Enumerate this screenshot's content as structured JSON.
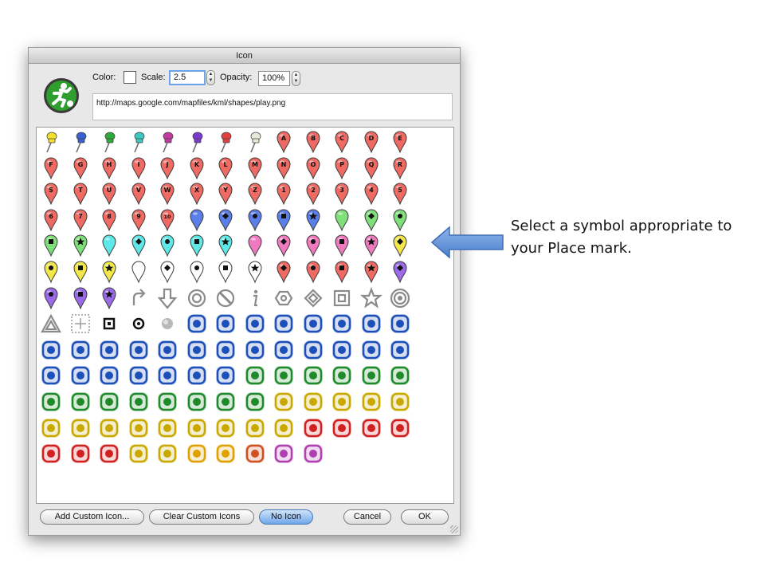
{
  "window": {
    "title": "Icon"
  },
  "preview": {
    "icon": "play-icon",
    "color": "#2e9e2e"
  },
  "controls": {
    "color_label": "Color:",
    "scale_label": "Scale:",
    "scale_value": "2.5",
    "opacity_label": "Opacity:",
    "opacity_value": "100%",
    "url": "http://maps.google.com/mapfiles/kml/shapes/play.png"
  },
  "buttons": {
    "add_custom": "Add Custom Icon...",
    "clear_custom": "Clear Custom Icons",
    "no_icon": "No Icon",
    "cancel": "Cancel",
    "ok": "OK"
  },
  "annotation": {
    "text": "Select a symbol appropriate to your Place mark.",
    "arrow_color": "#5b8fd6"
  },
  "icon_grid": {
    "rows": [
      [
        {
          "kind": "pushpin",
          "color": "#f2e02a"
        },
        {
          "kind": "pushpin",
          "color": "#3a5fd0"
        },
        {
          "kind": "pushpin",
          "color": "#2eaa3a"
        },
        {
          "kind": "pushpin",
          "color": "#3ac8c0"
        },
        {
          "kind": "pushpin",
          "color": "#c03aa0"
        },
        {
          "kind": "pushpin",
          "color": "#7a3ad0"
        },
        {
          "kind": "pushpin",
          "color": "#e04040"
        },
        {
          "kind": "pushpin",
          "color": "#e8e8d8"
        },
        {
          "kind": "pin",
          "color": "#ef6a62",
          "label": "A"
        },
        {
          "kind": "pin",
          "color": "#ef6a62",
          "label": "B"
        },
        {
          "kind": "pin",
          "color": "#ef6a62",
          "label": "C"
        },
        {
          "kind": "pin",
          "color": "#ef6a62",
          "label": "D"
        },
        {
          "kind": "pin",
          "color": "#ef6a62",
          "label": "E"
        }
      ],
      [
        {
          "kind": "pin",
          "color": "#ef6a62",
          "label": "F"
        },
        {
          "kind": "pin",
          "color": "#ef6a62",
          "label": "G"
        },
        {
          "kind": "pin",
          "color": "#ef6a62",
          "label": "H"
        },
        {
          "kind": "pin",
          "color": "#ef6a62",
          "label": "I"
        },
        {
          "kind": "pin",
          "color": "#ef6a62",
          "label": "J"
        },
        {
          "kind": "pin",
          "color": "#ef6a62",
          "label": "K"
        },
        {
          "kind": "pin",
          "color": "#ef6a62",
          "label": "L"
        },
        {
          "kind": "pin",
          "color": "#ef6a62",
          "label": "M"
        },
        {
          "kind": "pin",
          "color": "#ef6a62",
          "label": "N"
        },
        {
          "kind": "pin",
          "color": "#ef6a62",
          "label": "O"
        },
        {
          "kind": "pin",
          "color": "#ef6a62",
          "label": "P"
        },
        {
          "kind": "pin",
          "color": "#ef6a62",
          "label": "Q"
        },
        {
          "kind": "pin",
          "color": "#ef6a62",
          "label": "R"
        }
      ],
      [
        {
          "kind": "pin",
          "color": "#ef6a62",
          "label": "S"
        },
        {
          "kind": "pin",
          "color": "#ef6a62",
          "label": "T"
        },
        {
          "kind": "pin",
          "color": "#ef6a62",
          "label": "U"
        },
        {
          "kind": "pin",
          "color": "#ef6a62",
          "label": "V"
        },
        {
          "kind": "pin",
          "color": "#ef6a62",
          "label": "W"
        },
        {
          "kind": "pin",
          "color": "#ef6a62",
          "label": "X"
        },
        {
          "kind": "pin",
          "color": "#ef6a62",
          "label": "Y"
        },
        {
          "kind": "pin",
          "color": "#ef6a62",
          "label": "Z"
        },
        {
          "kind": "pin",
          "color": "#ef6a62",
          "label": "1"
        },
        {
          "kind": "pin",
          "color": "#ef6a62",
          "label": "2"
        },
        {
          "kind": "pin",
          "color": "#ef6a62",
          "label": "3"
        },
        {
          "kind": "pin",
          "color": "#ef6a62",
          "label": "4"
        },
        {
          "kind": "pin",
          "color": "#ef6a62",
          "label": "5"
        }
      ],
      [
        {
          "kind": "pin",
          "color": "#ef6a62",
          "label": "6"
        },
        {
          "kind": "pin",
          "color": "#ef6a62",
          "label": "7"
        },
        {
          "kind": "pin",
          "color": "#ef6a62",
          "label": "8"
        },
        {
          "kind": "pin",
          "color": "#ef6a62",
          "label": "9"
        },
        {
          "kind": "pin",
          "color": "#ef6a62",
          "label": "10"
        },
        {
          "kind": "pin",
          "color": "#5b7fe8"
        },
        {
          "kind": "pin",
          "color": "#5b7fe8",
          "glyph": "diamond"
        },
        {
          "kind": "pin",
          "color": "#5b7fe8",
          "glyph": "dot"
        },
        {
          "kind": "pin",
          "color": "#5b7fe8",
          "glyph": "square"
        },
        {
          "kind": "pin",
          "color": "#5b7fe8",
          "glyph": "star"
        },
        {
          "kind": "pin",
          "color": "#7fe07a"
        },
        {
          "kind": "pin",
          "color": "#7fe07a",
          "glyph": "diamond"
        },
        {
          "kind": "pin",
          "color": "#7fe07a",
          "glyph": "dot"
        }
      ],
      [
        {
          "kind": "pin",
          "color": "#7fe07a",
          "glyph": "square"
        },
        {
          "kind": "pin",
          "color": "#7fe07a",
          "glyph": "star"
        },
        {
          "kind": "pin",
          "color": "#5fe8e8"
        },
        {
          "kind": "pin",
          "color": "#5fe8e8",
          "glyph": "diamond"
        },
        {
          "kind": "pin",
          "color": "#5fe8e8",
          "glyph": "dot"
        },
        {
          "kind": "pin",
          "color": "#5fe8e8",
          "glyph": "square"
        },
        {
          "kind": "pin",
          "color": "#5fe8e8",
          "glyph": "star"
        },
        {
          "kind": "pin",
          "color": "#f07ac0"
        },
        {
          "kind": "pin",
          "color": "#f07ac0",
          "glyph": "diamond"
        },
        {
          "kind": "pin",
          "color": "#f07ac0",
          "glyph": "dot"
        },
        {
          "kind": "pin",
          "color": "#f07ac0",
          "glyph": "square"
        },
        {
          "kind": "pin",
          "color": "#f07ac0",
          "glyph": "star"
        },
        {
          "kind": "pin",
          "color": "#f2e84a",
          "glyph": "diamond"
        }
      ],
      [
        {
          "kind": "pin",
          "color": "#f2e84a",
          "glyph": "dot"
        },
        {
          "kind": "pin",
          "color": "#f2e84a",
          "glyph": "square"
        },
        {
          "kind": "pin",
          "color": "#f2e84a",
          "glyph": "star"
        },
        {
          "kind": "pin",
          "color": "#ffffff"
        },
        {
          "kind": "pin",
          "color": "#ffffff",
          "glyph": "diamond"
        },
        {
          "kind": "pin",
          "color": "#ffffff",
          "glyph": "dot"
        },
        {
          "kind": "pin",
          "color": "#ffffff",
          "glyph": "square"
        },
        {
          "kind": "pin",
          "color": "#ffffff",
          "glyph": "star"
        },
        {
          "kind": "pin",
          "color": "#ef6a62",
          "glyph": "diamond"
        },
        {
          "kind": "pin",
          "color": "#ef6a62",
          "glyph": "dot"
        },
        {
          "kind": "pin",
          "color": "#ef6a62",
          "glyph": "square"
        },
        {
          "kind": "pin",
          "color": "#ef6a62",
          "glyph": "star"
        },
        {
          "kind": "pin",
          "color": "#9a6ae8",
          "glyph": "diamond"
        }
      ],
      [
        {
          "kind": "pin",
          "color": "#9a6ae8",
          "glyph": "dot"
        },
        {
          "kind": "pin",
          "color": "#9a6ae8",
          "glyph": "square"
        },
        {
          "kind": "pin",
          "color": "#9a6ae8",
          "glyph": "star"
        },
        {
          "kind": "shape",
          "name": "turn-arrow-icon"
        },
        {
          "kind": "shape",
          "name": "down-arrow-icon"
        },
        {
          "kind": "shape",
          "name": "target-circle-icon"
        },
        {
          "kind": "shape",
          "name": "no-entry-icon"
        },
        {
          "kind": "shape",
          "name": "info-i-icon"
        },
        {
          "kind": "shape",
          "name": "hexagon-icon"
        },
        {
          "kind": "shape",
          "name": "diamond-outline-icon"
        },
        {
          "kind": "shape",
          "name": "square-outline-icon"
        },
        {
          "kind": "shape",
          "name": "star-outline-icon"
        },
        {
          "kind": "shape",
          "name": "bullseye-icon"
        }
      ],
      [
        {
          "kind": "shape",
          "name": "triangle-outline-icon"
        },
        {
          "kind": "shape",
          "name": "crosshair-square-icon"
        },
        {
          "kind": "shape",
          "name": "small-square-icon"
        },
        {
          "kind": "shape",
          "name": "small-dot-icon"
        },
        {
          "kind": "shape",
          "name": "gray-sphere-icon"
        },
        {
          "kind": "symbol",
          "name": "dining-icon",
          "color": "#1d4fb8"
        },
        {
          "kind": "symbol",
          "name": "coffee-icon",
          "color": "#1d4fb8"
        },
        {
          "kind": "symbol",
          "name": "bar-icon",
          "color": "#1d4fb8"
        },
        {
          "kind": "symbol",
          "name": "snack-bar-icon",
          "color": "#1d4fb8"
        },
        {
          "kind": "symbol",
          "name": "man-icon",
          "color": "#1d4fb8"
        },
        {
          "kind": "symbol",
          "name": "woman-icon",
          "color": "#1d4fb8"
        },
        {
          "kind": "symbol",
          "name": "wheelchair-icon",
          "color": "#1d4fb8"
        },
        {
          "kind": "symbol",
          "name": "parking-icon",
          "color": "#1d4fb8"
        }
      ],
      [
        {
          "kind": "symbol",
          "name": "car-icon",
          "color": "#1d4fb8"
        },
        {
          "kind": "symbol",
          "name": "bus-icon",
          "color": "#1d4fb8"
        },
        {
          "kind": "symbol",
          "name": "truck-icon",
          "color": "#1d4fb8"
        },
        {
          "kind": "symbol",
          "name": "rail-icon",
          "color": "#1d4fb8"
        },
        {
          "kind": "symbol",
          "name": "airport-icon",
          "color": "#1d4fb8"
        },
        {
          "kind": "symbol",
          "name": "ferry-icon",
          "color": "#1d4fb8"
        },
        {
          "kind": "symbol",
          "name": "helicopter-icon",
          "color": "#1d4fb8"
        },
        {
          "kind": "symbol",
          "name": "subway-icon",
          "color": "#1d4fb8"
        },
        {
          "kind": "symbol",
          "name": "tram-icon",
          "color": "#1d4fb8"
        },
        {
          "kind": "symbol",
          "name": "info-icon",
          "color": "#1d4fb8"
        },
        {
          "kind": "symbol",
          "name": "question-icon",
          "color": "#1d4fb8"
        },
        {
          "kind": "symbol",
          "name": "flag-icon",
          "color": "#1d4fb8"
        },
        {
          "kind": "symbol",
          "name": "rain-cloud-icon",
          "color": "#1d4fb8"
        }
      ],
      [
        {
          "kind": "symbol",
          "name": "water-waves-icon",
          "color": "#1d4fb8"
        },
        {
          "kind": "symbol",
          "name": "snowflake-icon",
          "color": "#1d4fb8"
        },
        {
          "kind": "symbol",
          "name": "anchor-icon",
          "color": "#1d4fb8"
        },
        {
          "kind": "symbol",
          "name": "fishing-icon",
          "color": "#1d4fb8"
        },
        {
          "kind": "symbol",
          "name": "sailing-icon",
          "color": "#1d4fb8"
        },
        {
          "kind": "symbol",
          "name": "swimming-icon",
          "color": "#1d4fb8"
        },
        {
          "kind": "symbol",
          "name": "ski-icon",
          "color": "#1d4fb8"
        },
        {
          "kind": "symbol",
          "name": "tree-icon",
          "color": "#1f8a2a"
        },
        {
          "kind": "symbol",
          "name": "campfire-icon",
          "color": "#1f8a2a"
        },
        {
          "kind": "symbol",
          "name": "picnic-icon",
          "color": "#1f8a2a"
        },
        {
          "kind": "symbol",
          "name": "camping-icon",
          "color": "#1f8a2a"
        },
        {
          "kind": "symbol",
          "name": "ranger-station-icon",
          "color": "#1f8a2a"
        },
        {
          "kind": "symbol",
          "name": "toilets-icon",
          "color": "#1f8a2a"
        }
      ],
      [
        {
          "kind": "symbol",
          "name": "poi-arrow-icon",
          "color": "#1f8a2a"
        },
        {
          "kind": "symbol",
          "name": "hiking-icon",
          "color": "#1f8a2a"
        },
        {
          "kind": "symbol",
          "name": "cycling-icon",
          "color": "#1f8a2a"
        },
        {
          "kind": "symbol",
          "name": "motorbike-icon",
          "color": "#1f8a2a"
        },
        {
          "kind": "symbol",
          "name": "horse-riding-icon",
          "color": "#1f8a2a"
        },
        {
          "kind": "symbol",
          "name": "play-icon",
          "color": "#1f8a2a"
        },
        {
          "kind": "symbol",
          "name": "golf-icon",
          "color": "#1f8a2a"
        },
        {
          "kind": "symbol",
          "name": "trail-icon",
          "color": "#1f8a2a"
        },
        {
          "kind": "symbol",
          "name": "shopping-icon",
          "color": "#c9a800"
        },
        {
          "kind": "symbol",
          "name": "movies-icon",
          "color": "#c9a800"
        },
        {
          "kind": "symbol",
          "name": "grocery-icon",
          "color": "#c9a800"
        },
        {
          "kind": "symbol",
          "name": "convenience-icon",
          "color": "#c9a800"
        },
        {
          "kind": "symbol",
          "name": "arts-icon",
          "color": "#c9a800"
        }
      ],
      [
        {
          "kind": "symbol",
          "name": "homegardenbusiness-icon",
          "color": "#c9a800"
        },
        {
          "kind": "symbol",
          "name": "electronics-icon",
          "color": "#c9a800"
        },
        {
          "kind": "symbol",
          "name": "mechanic-icon",
          "color": "#c9a800"
        },
        {
          "kind": "symbol",
          "name": "gas-station-icon",
          "color": "#c9a800"
        },
        {
          "kind": "symbol",
          "name": "realestate-icon",
          "color": "#c9a800"
        },
        {
          "kind": "symbol",
          "name": "salon-icon",
          "color": "#c9a800"
        },
        {
          "kind": "symbol",
          "name": "dollar-icon",
          "color": "#c9a800"
        },
        {
          "kind": "symbol",
          "name": "euro-icon",
          "color": "#c9a800"
        },
        {
          "kind": "symbol",
          "name": "yen-icon",
          "color": "#c9a800"
        },
        {
          "kind": "symbol",
          "name": "firedept-icon",
          "color": "#d02020"
        },
        {
          "kind": "symbol",
          "name": "hospital-icon",
          "color": "#d02020"
        },
        {
          "kind": "symbol",
          "name": "lodging-icon",
          "color": "#d02020"
        },
        {
          "kind": "symbol",
          "name": "phone-icon",
          "color": "#d02020"
        }
      ],
      [
        {
          "kind": "symbol",
          "name": "caution-icon",
          "color": "#d02020"
        },
        {
          "kind": "symbol",
          "name": "earthquake-icon",
          "color": "#d02020"
        },
        {
          "kind": "symbol",
          "name": "falling-rocks-icon",
          "color": "#d02020"
        },
        {
          "kind": "symbol",
          "name": "post-office-icon",
          "color": "#c9a800"
        },
        {
          "kind": "symbol",
          "name": "police-icon",
          "color": "#c9a800"
        },
        {
          "kind": "symbol",
          "name": "sunny-icon",
          "color": "#e0a000"
        },
        {
          "kind": "symbol",
          "name": "partly-cloudy-icon",
          "color": "#e0a000"
        },
        {
          "kind": "symbol",
          "name": "volcano-icon",
          "color": "#d05020"
        },
        {
          "kind": "symbol",
          "name": "camera-icon",
          "color": "#b040b0"
        },
        {
          "kind": "symbol",
          "name": "webcam-icon",
          "color": "#b040b0"
        }
      ]
    ]
  }
}
